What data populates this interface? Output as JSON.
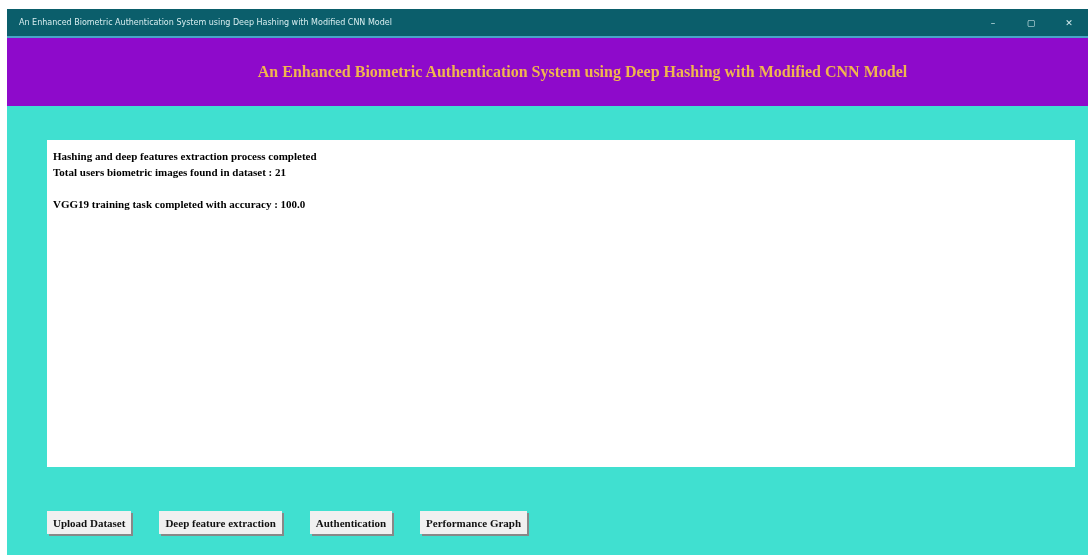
{
  "window": {
    "title": "An Enhanced Biometric Authentication System using Deep Hashing with Modified CNN Model",
    "controls": [
      "–",
      "▢",
      "✕"
    ]
  },
  "header": {
    "title": "An Enhanced Biometric Authentication System using Deep Hashing with Modified CNN Model"
  },
  "output": {
    "paragraphs": [
      [
        "Hashing and deep features extraction process completed",
        "Total users biometric images found in dataset : 21"
      ],
      [
        "VGG19 training task completed with accuracy : 100.0"
      ]
    ]
  },
  "buttons": [
    "Upload Dataset",
    "Deep feature extraction",
    "Authentication",
    "Performance Graph"
  ]
}
